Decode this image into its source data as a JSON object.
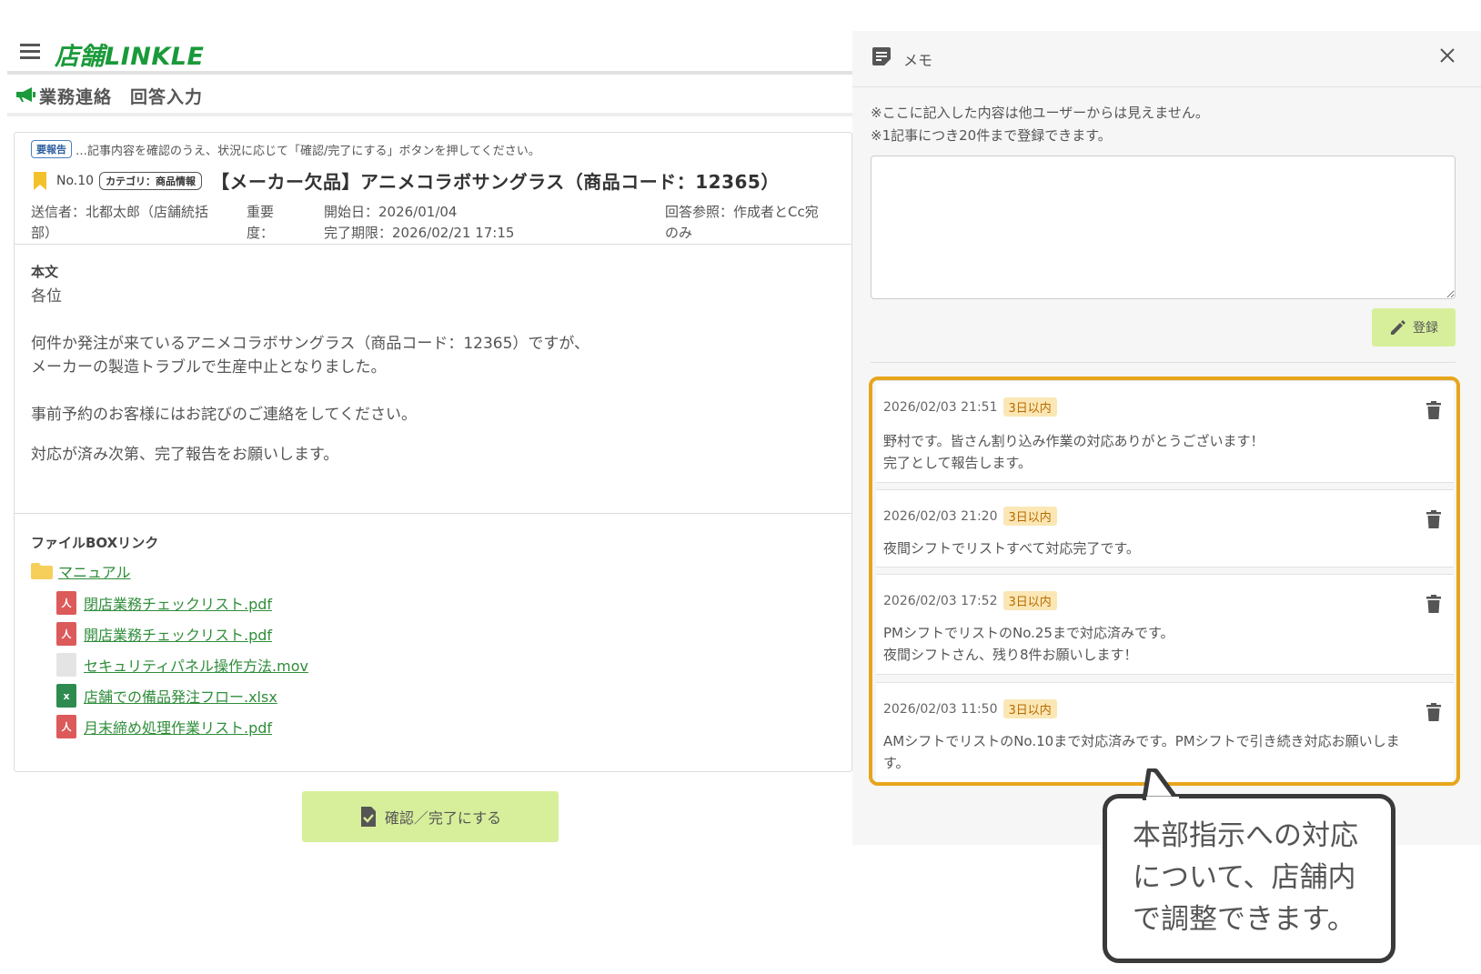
{
  "app": {
    "logo": "店舗LINKLE"
  },
  "page": {
    "title": "業務連絡　回答入力"
  },
  "article": {
    "badge": "要報告",
    "notice": "…記事内容を確認のうえ、状況に応じて「確認/完了にする」ボタンを押してください。",
    "number": "No.10",
    "category": "カテゴリ：商品情報",
    "title": "【メーカー欠品】アニメコラボサングラス（商品コード：12365）",
    "sender_line1": "送信者：北都太郎（店舗統括",
    "sender_line2": "部）",
    "importance_line1": "重要",
    "importance_line2": "度：",
    "start_date": "開始日：2026/01/04",
    "due_date": "完了期限：2026/02/21 17:15",
    "ref_line1": "回答参照：作成者とCc宛",
    "ref_line2": "のみ",
    "body_label": "本文",
    "body": {
      "l1": "各位",
      "l2": "何件か発注が来ているアニメコラボサングラス（商品コード：12365）ですが、",
      "l3": "メーカーの製造トラブルで生産中止となりました。",
      "l4": "事前予約のお客様にはお詫びのご連絡をしてください。",
      "l5": "対応が済み次第、完了報告をお願いします。"
    },
    "files_label": "ファイルBOXリンク",
    "folder": "マニュアル",
    "files": [
      {
        "name": "閉店業務チェックリスト.pdf",
        "type": "pdf"
      },
      {
        "name": "開店業務チェックリスト.pdf",
        "type": "pdf"
      },
      {
        "name": "セキュリティパネル操作方法.mov",
        "type": "mov"
      },
      {
        "name": "店舗での備品発注フロー.xlsx",
        "type": "xlsx"
      },
      {
        "name": "月末締め処理作業リスト.pdf",
        "type": "pdf"
      }
    ],
    "confirm_label": "確認／完了にする"
  },
  "memo": {
    "title": "メモ",
    "note1": "※ここに記入した内容は他ユーザーからは見えません。",
    "note2": "※1記事につき20件まで登録できます。",
    "textarea_value": "",
    "register_label": "登録",
    "items": [
      {
        "time": "2026/02/03 21:51",
        "badge": "3日以内",
        "line1": "野村です。皆さん割り込み作業の対応ありがとうございます！",
        "line2": "完了として報告します。"
      },
      {
        "time": "2026/02/03 21:20",
        "badge": "3日以内",
        "line1": "夜間シフトでリストすべて対応完了です。",
        "line2": ""
      },
      {
        "time": "2026/02/03 17:52",
        "badge": "3日以内",
        "line1": "PMシフトでリストのNo.25まで対応済みです。",
        "line2": "夜間シフトさん、残り8件お願いします！"
      },
      {
        "time": "2026/02/03 11:50",
        "badge": "3日以内",
        "line1": "AMシフトでリストのNo.10まで対応済みです。PMシフトで引き続き対応お願いしま",
        "line2": "す。"
      }
    ]
  },
  "callout": {
    "line1": "本部指示への対応",
    "line2": "について、店舗内",
    "line3": "で調整できます。"
  },
  "colors": {
    "brand": "#1a9a3a",
    "button": "#d7ef9b",
    "highlight": "#e7a51c",
    "link": "#2f8d3a",
    "badge_days_bg": "#fbe7b5"
  }
}
